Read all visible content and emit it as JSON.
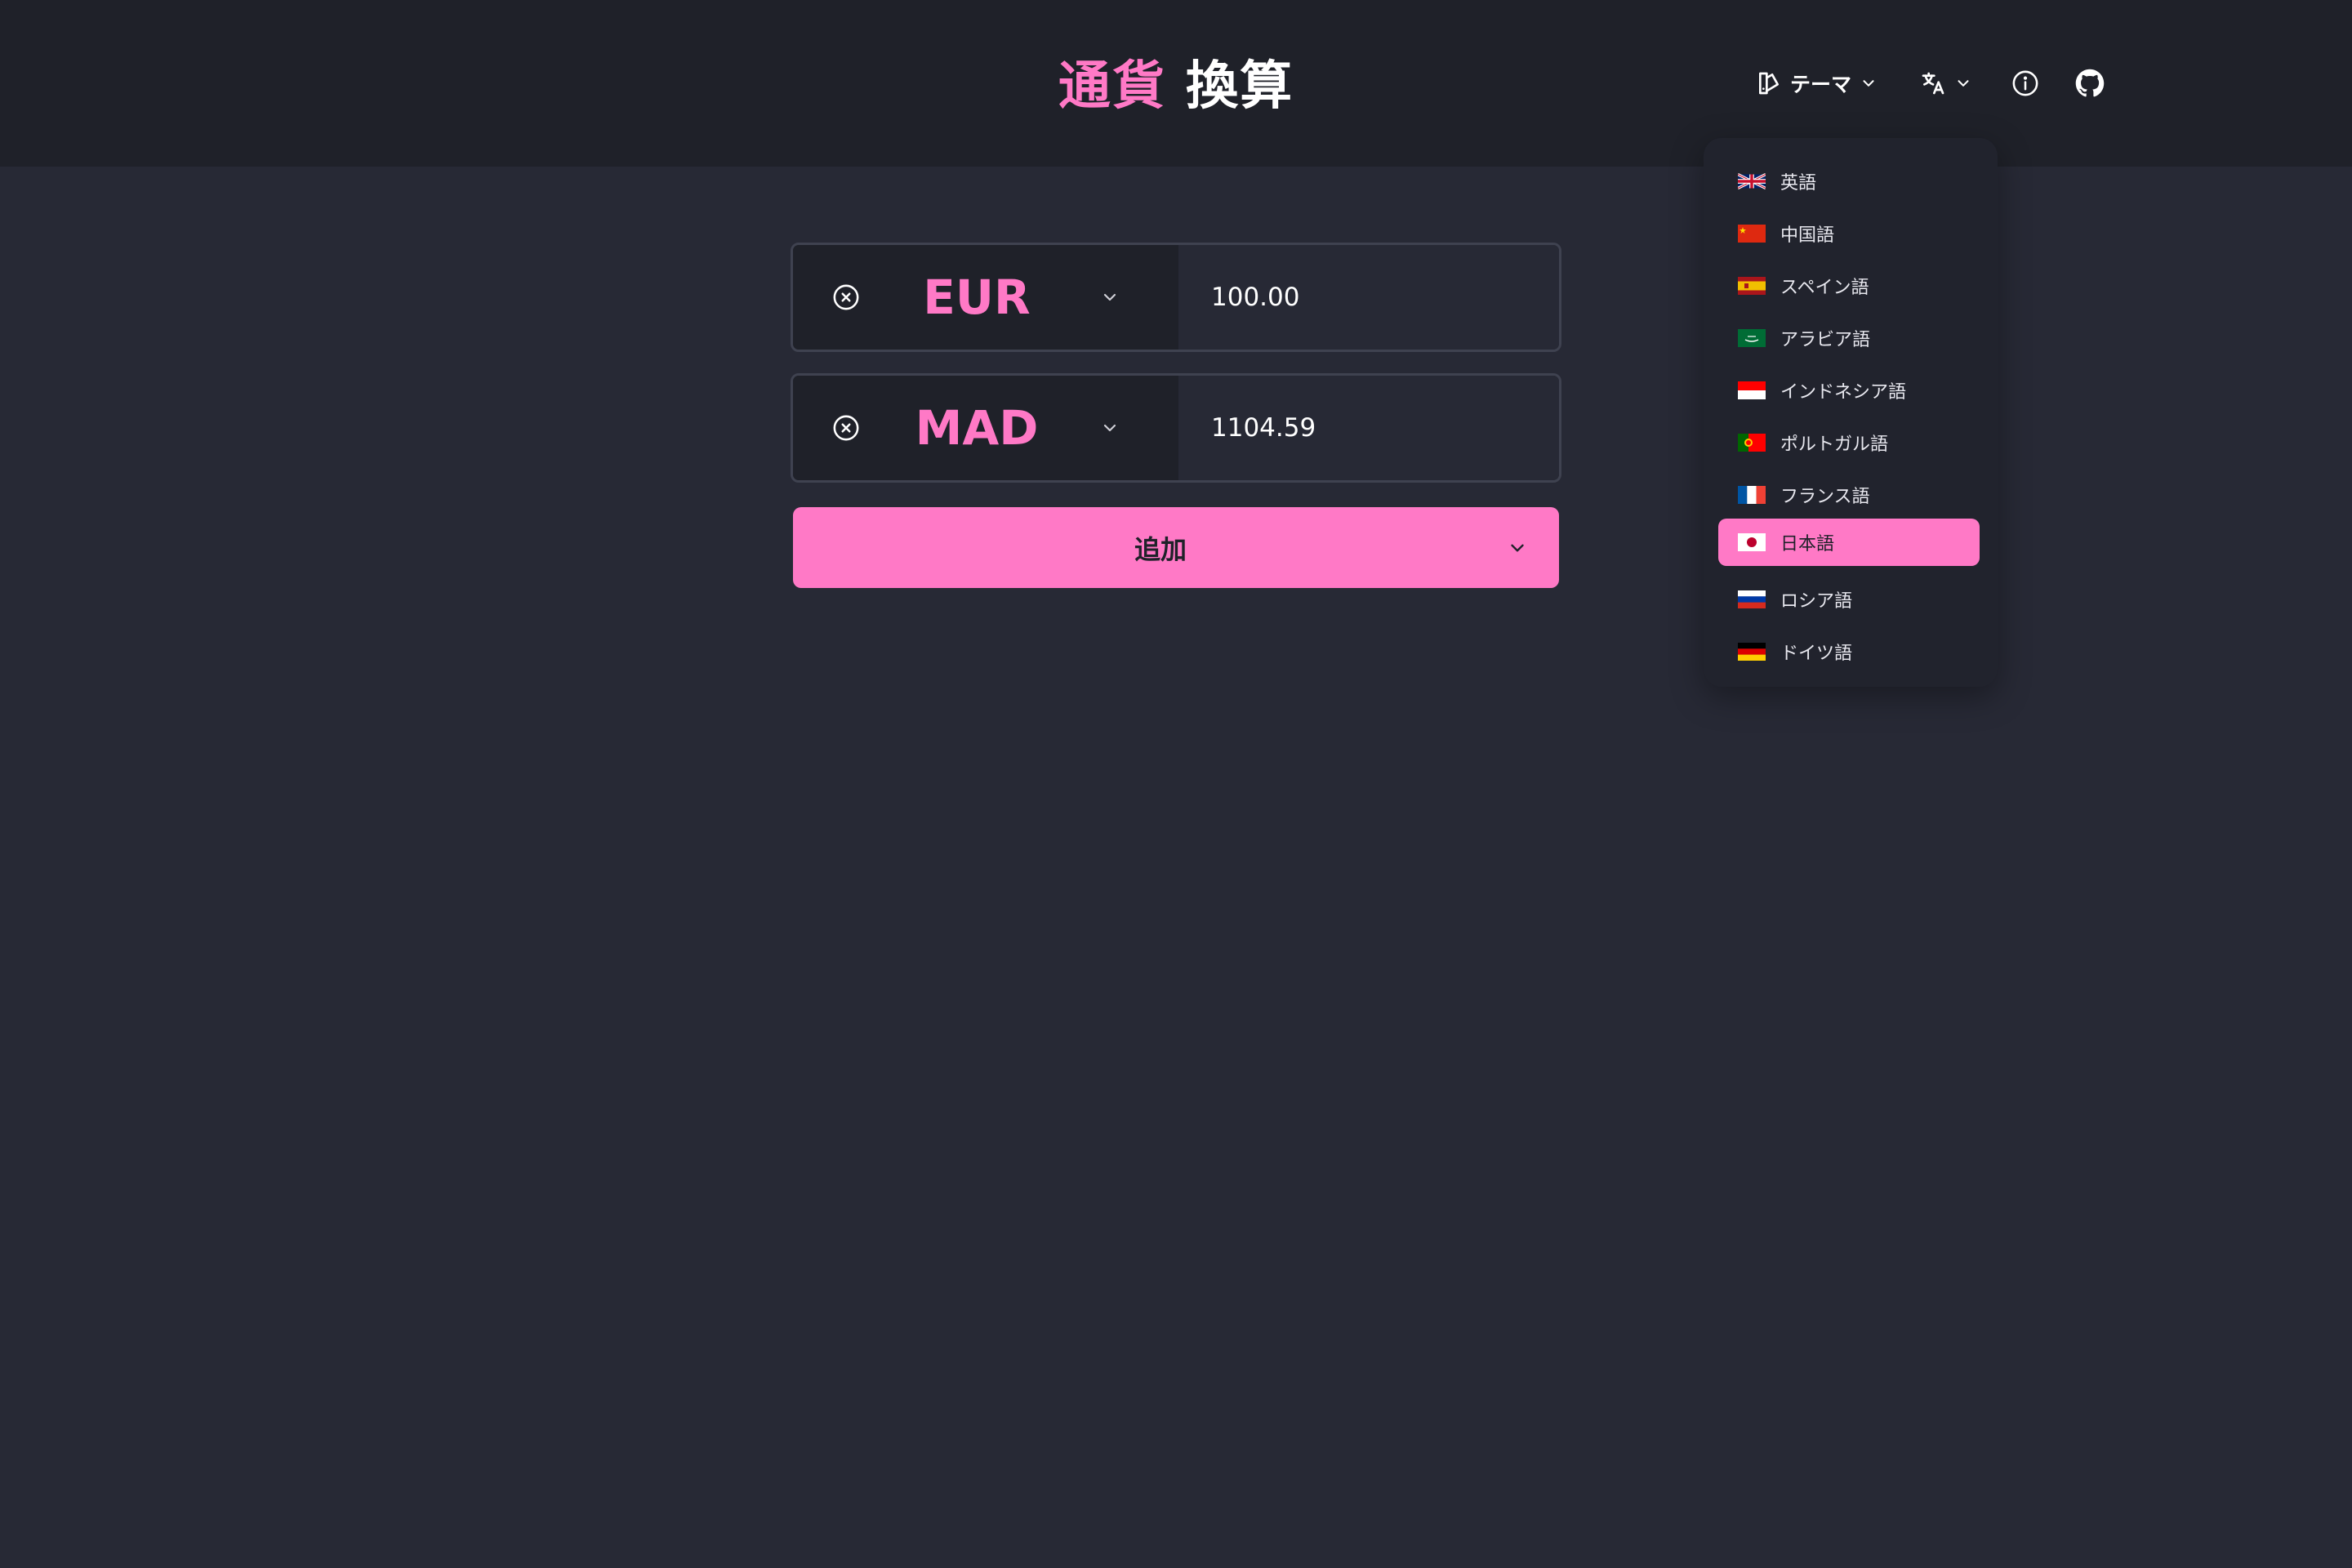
{
  "header": {
    "title_accent": "通貨",
    "title_plain": "換算",
    "theme_label": "テーマ",
    "icons": [
      "palette-icon",
      "translate-icon",
      "info-icon",
      "github-icon"
    ]
  },
  "converter": {
    "rows": [
      {
        "currency": "EUR",
        "amount": "100.00"
      },
      {
        "currency": "MAD",
        "amount": "1104.59"
      }
    ],
    "add_label": "追加"
  },
  "language_menu": {
    "selected": "日本語",
    "items": [
      {
        "label": "英語",
        "flag": "gb"
      },
      {
        "label": "中国語",
        "flag": "cn"
      },
      {
        "label": "スペイン語",
        "flag": "es"
      },
      {
        "label": "アラビア語",
        "flag": "sa"
      },
      {
        "label": "インドネシア語",
        "flag": "id"
      },
      {
        "label": "ポルトガル語",
        "flag": "pt"
      },
      {
        "label": "フランス語",
        "flag": "fr"
      },
      {
        "label": "日本語",
        "flag": "jp"
      },
      {
        "label": "ロシア語",
        "flag": "ru"
      },
      {
        "label": "ドイツ語",
        "flag": "de"
      }
    ]
  },
  "colors": {
    "accent": "#ff79c6",
    "background": "#272935",
    "navbar": "#1f2129"
  }
}
